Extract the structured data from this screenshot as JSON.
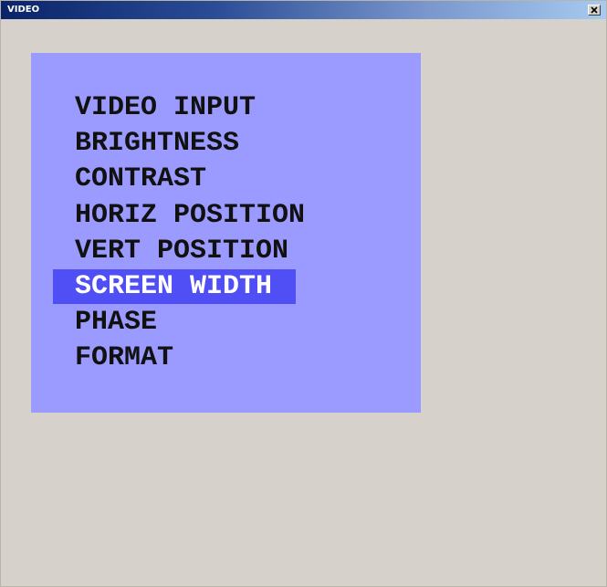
{
  "window": {
    "title": "VIDEO"
  },
  "menu": {
    "items": [
      {
        "label": "VIDEO INPUT",
        "selected": false
      },
      {
        "label": "BRIGHTNESS",
        "selected": false
      },
      {
        "label": "CONTRAST",
        "selected": false
      },
      {
        "label": "HORIZ POSITION",
        "selected": false
      },
      {
        "label": "VERT POSITION",
        "selected": false
      },
      {
        "label": "SCREEN WIDTH",
        "selected": true
      },
      {
        "label": "PHASE",
        "selected": false
      },
      {
        "label": "FORMAT",
        "selected": false
      }
    ]
  },
  "colors": {
    "titlebar_start": "#0a246a",
    "titlebar_end": "#a6caf0",
    "window_background": "#d6d2cb",
    "osd_background": "#9a9aff",
    "selection_background": "#4f4ff5",
    "menu_text": "#111111",
    "selected_text": "#ffffff"
  },
  "icons": {
    "close": "close-icon"
  }
}
